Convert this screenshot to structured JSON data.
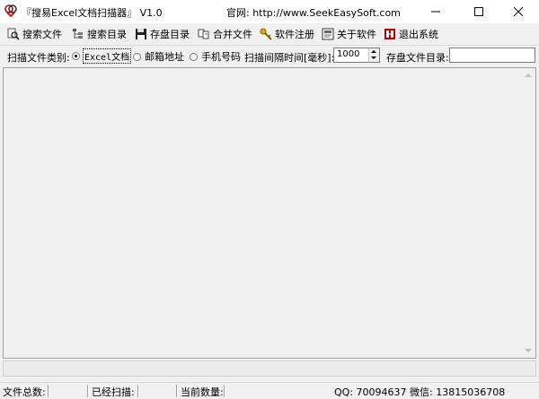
{
  "titlebar": {
    "app_title": "『搜易Excel文档扫描器』 V1.0",
    "site_text": "官网: http://www.SeekEasySoft.com",
    "minimize_icon": "minimize-icon",
    "maximize_icon": "maximize-icon",
    "close_icon": "close-icon"
  },
  "toolbar": {
    "items": [
      {
        "label": "搜索文件",
        "icon": "search-icon"
      },
      {
        "label": "搜索目录",
        "icon": "folder-tree-icon"
      },
      {
        "label": "存盘目录",
        "icon": "floppy-disk-icon"
      },
      {
        "label": "合并文件",
        "icon": "merge-icon"
      },
      {
        "label": "软件注册",
        "icon": "key-icon"
      },
      {
        "label": "关于软件",
        "icon": "info-icon"
      },
      {
        "label": "退出系统",
        "icon": "exit-icon"
      }
    ]
  },
  "options": {
    "scan_type_label": "扫描文件类别:",
    "radios": [
      {
        "label": "Excel文档",
        "selected": true
      },
      {
        "label": "邮箱地址",
        "selected": false
      },
      {
        "label": "手机号码",
        "selected": false
      }
    ],
    "interval_label": "扫描间隔时间[毫秒]:",
    "interval_value": "1000",
    "save_dir_label": "存盘文件目录:",
    "save_dir_value": ""
  },
  "statusbar": {
    "total_files": "文件总数:",
    "scanned": "已经扫描:",
    "current_count": "当前数量:",
    "contact": "QQ: 70094637 微信: 13815036708"
  },
  "colors": {
    "window_bg": "#f0f0f0",
    "titlebar_bg": "#ffffff"
  }
}
